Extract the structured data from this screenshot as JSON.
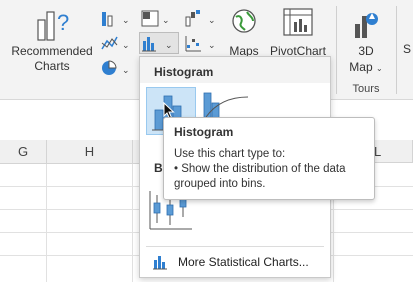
{
  "ribbon": {
    "recommended_charts": {
      "line1": "Recommended",
      "line2": "Charts"
    },
    "maps_label": "Maps",
    "pivotchart_label": "PivotChart",
    "map3d": {
      "line1": "3D",
      "line2": "Map"
    },
    "tours_group": "Tours",
    "cut_label": "S"
  },
  "sheet": {
    "columns": [
      "G",
      "H",
      "L"
    ]
  },
  "dropdown": {
    "section_histogram": "Histogram",
    "section_box_partial": "B",
    "more_link": "More Statistical Charts..."
  },
  "tooltip": {
    "title": "Histogram",
    "line1": "Use this chart type to:",
    "line2": "• Show the distribution of the data",
    "line3": "grouped into bins."
  },
  "colors": {
    "accent_blue": "#2f7fd0",
    "selected_bg": "#cce4f7",
    "selected_border": "#99c9ef"
  }
}
